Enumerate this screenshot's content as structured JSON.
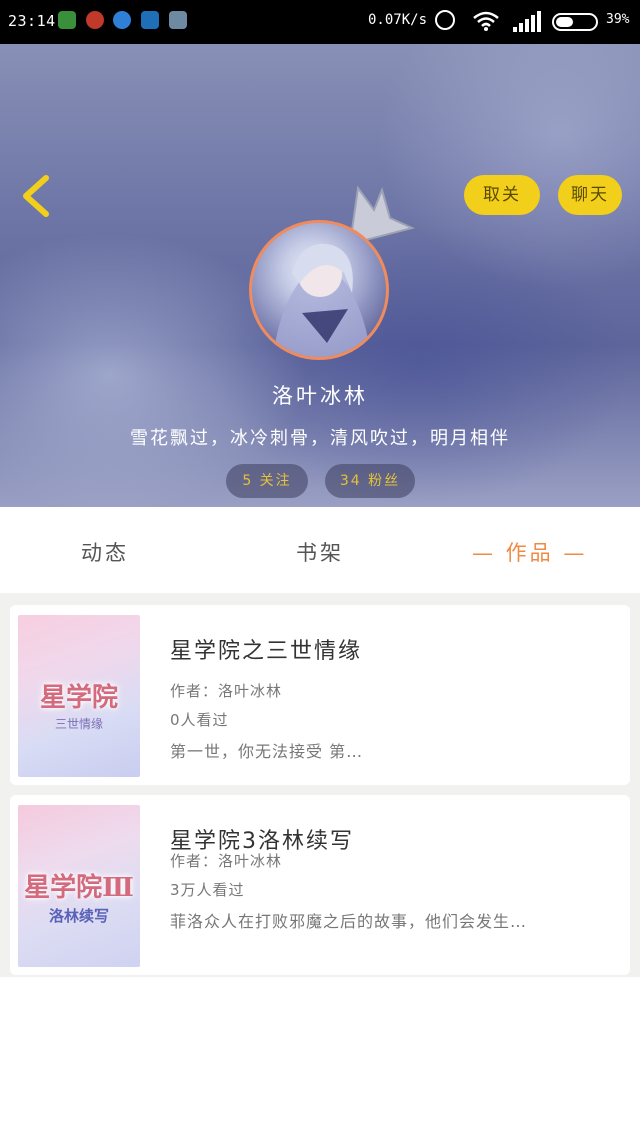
{
  "status_bar": {
    "time": "23:14",
    "net_speed": "0.07K/s",
    "battery": "39%"
  },
  "header": {
    "unfollow_label": "取关",
    "chat_label": "聊天",
    "username": "洛叶冰林",
    "bio": "雪花飘过，冰冷刺骨，清风吹过，明月相伴",
    "follow_count": "5 关注",
    "fans_count": "34 粉丝",
    "accent": "#f2cf1a"
  },
  "tabs": {
    "dynamic": "动态",
    "bookshelf": "书架",
    "works": "— 作品 —",
    "active_color": "#ef8a45"
  },
  "works": [
    {
      "title": "星学院之三世情缘",
      "author": "作者：洛叶冰林",
      "views": "0人看过",
      "summary": "第一世，你无法接受 第…",
      "cover_title": "星学院",
      "cover_subtitle": "三世情缘"
    },
    {
      "title": "星学院3洛林续写",
      "author": "作者：洛叶冰林",
      "views": "3万人看过",
      "summary": "菲洛众人在打败邪魔之后的故事，他们会发生…",
      "cover_title": "星学院Ⅲ",
      "cover_subtitle": "洛林续写"
    }
  ]
}
